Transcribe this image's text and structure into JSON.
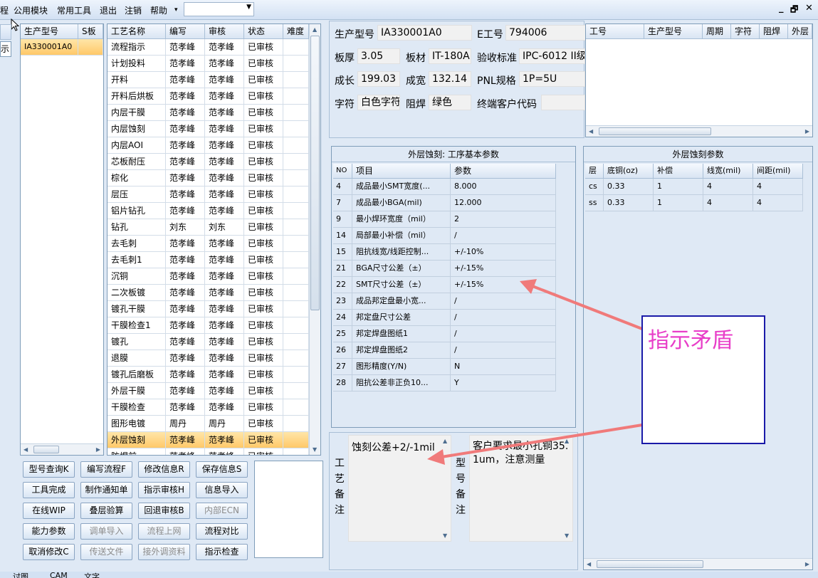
{
  "menu": {
    "items": [
      "公用模块",
      "常用工具",
      "退出",
      "注销",
      "帮助"
    ],
    "help_arrow": "▾",
    "combo_value": "",
    "window_buttons": [
      "_",
      "🗗",
      "✕"
    ]
  },
  "left_edge": {
    "tab_text": "示"
  },
  "model_list": {
    "columns": [
      "生产型号",
      "S板"
    ],
    "rows": [
      [
        "IA330001A0",
        ""
      ]
    ]
  },
  "process_table": {
    "columns": [
      "工艺名称",
      "编写",
      "审核",
      "状态",
      "难度"
    ],
    "rows": [
      [
        "流程指示",
        "范孝峰",
        "范孝峰",
        "已审核",
        ""
      ],
      [
        "计划投料",
        "范孝峰",
        "范孝峰",
        "已审核",
        ""
      ],
      [
        "开料",
        "范孝峰",
        "范孝峰",
        "已审核",
        ""
      ],
      [
        "开料后烘板",
        "范孝峰",
        "范孝峰",
        "已审核",
        ""
      ],
      [
        "内层干膜",
        "范孝峰",
        "范孝峰",
        "已审核",
        ""
      ],
      [
        "内层蚀刻",
        "范孝峰",
        "范孝峰",
        "已审核",
        ""
      ],
      [
        "内层AOI",
        "范孝峰",
        "范孝峰",
        "已审核",
        ""
      ],
      [
        "芯板耐压",
        "范孝峰",
        "范孝峰",
        "已审核",
        ""
      ],
      [
        "棕化",
        "范孝峰",
        "范孝峰",
        "已审核",
        ""
      ],
      [
        "层压",
        "范孝峰",
        "范孝峰",
        "已审核",
        ""
      ],
      [
        "铝片钻孔",
        "范孝峰",
        "范孝峰",
        "已审核",
        ""
      ],
      [
        "钻孔",
        "刘东",
        "刘东",
        "已审核",
        ""
      ],
      [
        "去毛刺",
        "范孝峰",
        "范孝峰",
        "已审核",
        ""
      ],
      [
        "去毛刺1",
        "范孝峰",
        "范孝峰",
        "已审核",
        ""
      ],
      [
        "沉铜",
        "范孝峰",
        "范孝峰",
        "已审核",
        ""
      ],
      [
        "二次板镀",
        "范孝峰",
        "范孝峰",
        "已审核",
        ""
      ],
      [
        "镀孔干膜",
        "范孝峰",
        "范孝峰",
        "已审核",
        ""
      ],
      [
        "干膜检查1",
        "范孝峰",
        "范孝峰",
        "已审核",
        ""
      ],
      [
        "镀孔",
        "范孝峰",
        "范孝峰",
        "已审核",
        ""
      ],
      [
        "退膜",
        "范孝峰",
        "范孝峰",
        "已审核",
        ""
      ],
      [
        "镀孔后磨板",
        "范孝峰",
        "范孝峰",
        "已审核",
        ""
      ],
      [
        "外层干膜",
        "范孝峰",
        "范孝峰",
        "已审核",
        ""
      ],
      [
        "干膜检查",
        "范孝峰",
        "范孝峰",
        "已审核",
        ""
      ],
      [
        "图形电镀",
        "周丹",
        "周丹",
        "已审核",
        ""
      ],
      [
        "外层蚀刻",
        "范孝峰",
        "范孝峰",
        "已审核",
        ""
      ],
      [
        "防焊前",
        "范孝峰",
        "范孝峰",
        "已审核",
        ""
      ]
    ],
    "selected_index": 24
  },
  "buttons": [
    [
      "型号查询K",
      "编写流程F",
      "修改信息R",
      "保存信息S"
    ],
    [
      "工具完成",
      "制作通知单",
      "指示审核H",
      "信息导入"
    ],
    [
      "在线WIP",
      "叠层验算",
      "回退审核B",
      "内部ECN"
    ],
    [
      "能力参数",
      "调单导入",
      "流程上网",
      "流程对比"
    ],
    [
      "取消修改C",
      "传送文件",
      "接外调资料",
      "指示检查"
    ]
  ],
  "disabled_buttons": [
    "内部ECN",
    "调单导入",
    "流程上网",
    "传送文件",
    "接外调资料"
  ],
  "info": {
    "model_label": "生产型号",
    "model_value": "IA330001A0",
    "e_label": "E工号",
    "e_value": "794006",
    "thickness_label": "板厚",
    "thickness_value": "3.05",
    "material_label": "板材",
    "material_value": "IT-180A",
    "standard_label": "验收标准",
    "standard_value": "IPC-6012 II级",
    "length_label": "成长",
    "length_value": "199.03",
    "width_label": "成宽",
    "width_value": "132.14",
    "pnl_label": "PNL规格",
    "pnl_value": "1P=5U",
    "char_label": "字符",
    "char_value": "白色字符",
    "mask_label": "阻焊",
    "mask_value": "绿色",
    "customer_label": "终端客户代码",
    "customer_value": ""
  },
  "right_top_table": {
    "columns": [
      "工号",
      "生产型号",
      "周期",
      "字符",
      "阻焊",
      "外层"
    ]
  },
  "params_panel": {
    "title": "外层蚀刻: 工序基本参数",
    "columns": [
      "NO",
      "项目",
      "参数"
    ],
    "rows": [
      [
        "4",
        "成品最小SMT宽度(...",
        "8.000"
      ],
      [
        "7",
        "成品最小BGA(mil)",
        "12.000"
      ],
      [
        "9",
        "最小焊环宽度（mil）",
        "2"
      ],
      [
        "14",
        "局部最小补偿（mil）",
        "/"
      ],
      [
        "15",
        "阻抗线宽/线距控制...",
        "+/-10%"
      ],
      [
        "21",
        "BGA尺寸公差（±）",
        "+/-15%"
      ],
      [
        "22",
        "SMT尺寸公差（±）",
        "+/-15%"
      ],
      [
        "23",
        "成品邦定盘最小宽...",
        "/"
      ],
      [
        "24",
        "邦定盘尺寸公差",
        "/"
      ],
      [
        "25",
        "邦定焊盘图纸1",
        "/"
      ],
      [
        "26",
        "邦定焊盘图纸2",
        "/"
      ],
      [
        "27",
        "图形精度(Y/N)",
        "N"
      ],
      [
        "28",
        "阻抗公差非正负10...",
        "Y"
      ]
    ]
  },
  "etch_panel": {
    "title": "外层蚀刻参数",
    "columns": [
      "层",
      "底铜(oz)",
      "补偿",
      "线宽(mil)",
      "间距(mil)"
    ],
    "rows": [
      [
        "cs",
        "0.33",
        "1",
        "4",
        "4"
      ],
      [
        "ss",
        "0.33",
        "1",
        "4",
        "4"
      ]
    ]
  },
  "notes": {
    "process_label": "工艺备注",
    "process_text": "蚀刻公差+2/-1mil",
    "model_label": "型号备注",
    "model_text": "客户要求最小孔铜35.1um，注意测量"
  },
  "annotation": {
    "text": "指示矛盾",
    "color": "#e83ec8",
    "arrow_color": "#f07a7a"
  },
  "bottom_tabs": [
    "讨图",
    "CAM",
    "文字"
  ]
}
